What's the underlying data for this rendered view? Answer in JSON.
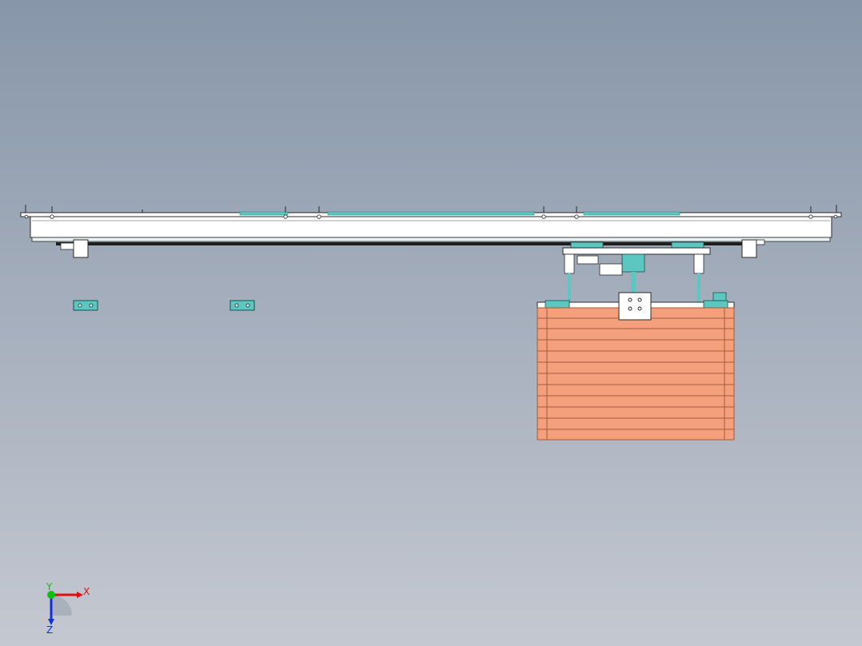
{
  "viewport": {
    "background_top": "#8796a9",
    "background_bottom": "#c4c8d1"
  },
  "colors": {
    "frame_fill": "#ffffff",
    "frame_edge": "#2a2a2a",
    "cyan_part": "#5cc6c0",
    "cyan_dark": "#2f8f8a",
    "salmon_bellows": "#f4a07c",
    "salmon_edge": "#a35a3c",
    "axis_x": "#e01010",
    "axis_y": "#10c010",
    "axis_z": "#1030e0"
  },
  "triad": {
    "x_label": "X",
    "y_label": "Y",
    "z_label": "Z"
  }
}
